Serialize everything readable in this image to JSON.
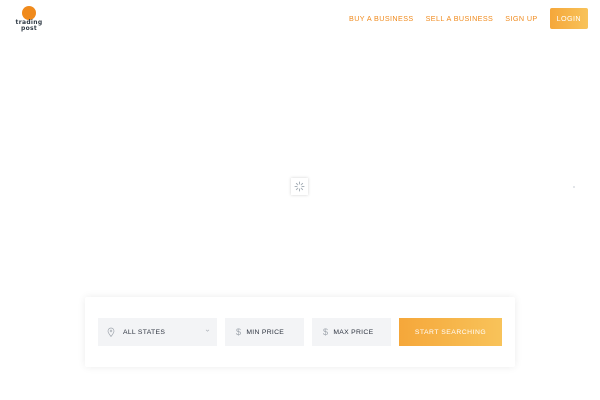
{
  "header": {
    "logo": {
      "line1": "trading",
      "line2": "post"
    },
    "nav": [
      {
        "label": "BUY A BUSINESS"
      },
      {
        "label": "SELL A BUSINESS"
      },
      {
        "label": "SIGN UP"
      }
    ],
    "login_label": "LOGIN"
  },
  "search": {
    "state": "ALL STATES",
    "min_price": "MIN PRICE",
    "max_price": "MAX PRICE",
    "button": "START SEARCHING"
  },
  "icons": {
    "logo": "trading-post-logo",
    "location": "location-pin-icon",
    "dropdown": "chevron-down-icon",
    "currency": "dollar-icon",
    "loading": "loading-spinner-icon"
  },
  "colors": {
    "accent": "#f08a1c",
    "button_start": "#f5a73a",
    "button_end": "#f8c35a",
    "field_bg": "#f3f4f6",
    "text": "#2e3440"
  }
}
